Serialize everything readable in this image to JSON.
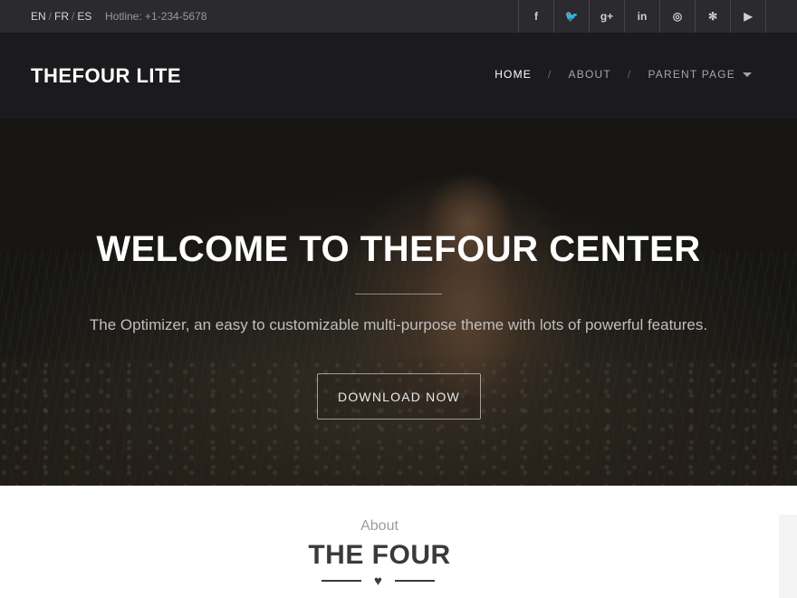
{
  "topbar": {
    "languages": [
      "EN",
      "FR",
      "ES"
    ],
    "lang_sep": "/",
    "hotline": "Hotline: +1-234-5678",
    "social": [
      {
        "icon": "facebook-icon",
        "glyph": "f"
      },
      {
        "icon": "twitter-icon",
        "glyph": "🐦"
      },
      {
        "icon": "google-plus-icon",
        "glyph": "g+"
      },
      {
        "icon": "linkedin-icon",
        "glyph": "in"
      },
      {
        "icon": "instagram-icon",
        "glyph": "◎"
      },
      {
        "icon": "yelp-icon",
        "glyph": "✻"
      },
      {
        "icon": "youtube-icon",
        "glyph": "▶"
      }
    ]
  },
  "header": {
    "brand": "THEFOUR LITE",
    "nav": {
      "home": "HOME",
      "about": "ABOUT",
      "parent": "PARENT PAGE",
      "divider": "/"
    }
  },
  "hero": {
    "title": "WELCOME TO THEFOUR CENTER",
    "subtitle": "The Optimizer, an easy to customizable multi-purpose theme with lots of powerful features.",
    "button": "DOWNLOAD NOW"
  },
  "about": {
    "kicker": "About",
    "title": "THE FOUR",
    "heart": "♥"
  },
  "colors": {
    "topbar_bg": "#2b2a2e",
    "navbar_bg": "#1e1d21",
    "title_text": "#3a3a3a"
  }
}
